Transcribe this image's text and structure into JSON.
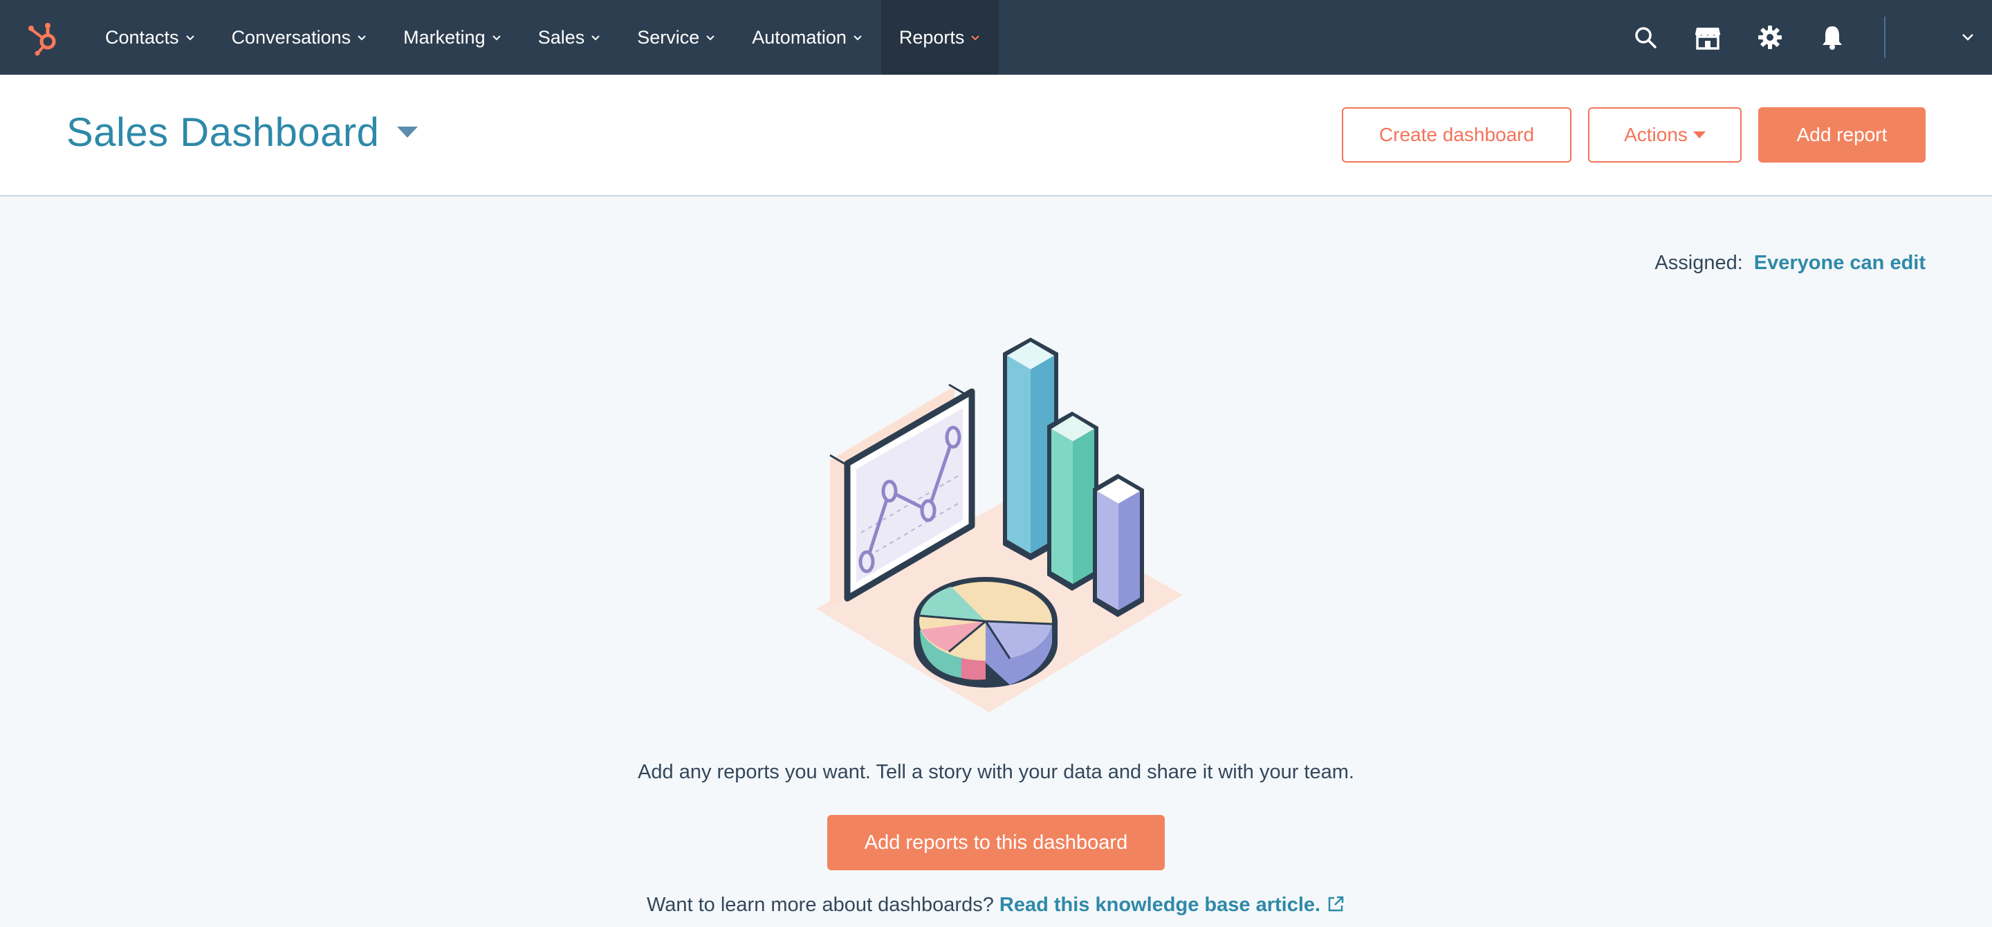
{
  "nav": {
    "logo": "hubspot-sprocket-icon",
    "items": [
      {
        "label": "Contacts"
      },
      {
        "label": "Conversations"
      },
      {
        "label": "Marketing"
      },
      {
        "label": "Sales"
      },
      {
        "label": "Service"
      },
      {
        "label": "Automation"
      },
      {
        "label": "Reports",
        "active": true
      }
    ],
    "icons": [
      "search-icon",
      "marketplace-icon",
      "gear-icon",
      "bell-icon",
      "chevron-down-icon"
    ]
  },
  "header": {
    "title": "Sales Dashboard",
    "create_dashboard_label": "Create dashboard",
    "actions_label": "Actions",
    "add_report_label": "Add report"
  },
  "main": {
    "assigned_label": "Assigned:",
    "assigned_value": "Everyone can edit",
    "empty_message": "Add any reports you want. Tell a story with your data and share it with your team.",
    "add_reports_button": "Add reports to this dashboard",
    "learn_more_prefix": "Want to learn more about dashboards?",
    "learn_more_link": "Read this knowledge base article."
  },
  "colors": {
    "nav_bg": "#2d3e50",
    "accent_orange": "#f2835f",
    "link_teal": "#2e89a8",
    "page_bg": "#f5f8fa"
  }
}
